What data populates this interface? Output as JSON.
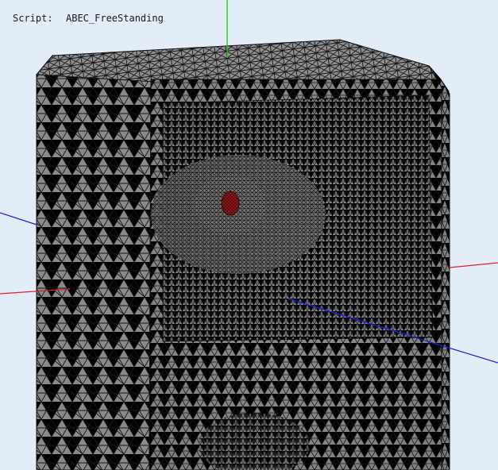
{
  "header": {
    "script_label": "Script:",
    "script_name": "ABEC_FreeStanding"
  },
  "scene": {
    "background": "#e3edf8",
    "mesh_face_color": "#8c8c8c",
    "mesh_edge_color": "#111111",
    "driver_color": "#9a1a1a",
    "axis_x_color": "#e0202a",
    "axis_y_color": "#22c020",
    "axis_z_color": "#2020e0"
  }
}
